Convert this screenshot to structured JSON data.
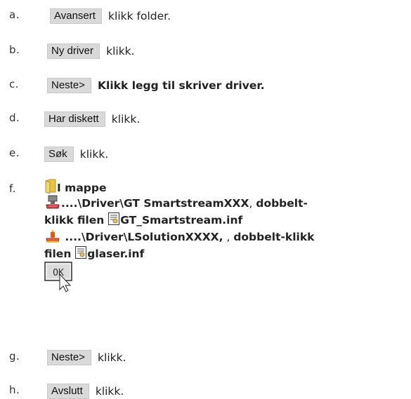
{
  "steps": [
    {
      "marker": "a.",
      "button": "Avansert",
      "text": "klikk folder."
    },
    {
      "marker": "b.",
      "button": "Ny driver",
      "text": "klikk."
    },
    {
      "marker": "c.",
      "button": "Neste>",
      "text": "Klikk legg til skriver driver."
    },
    {
      "marker": "d.",
      "button": "Har diskett",
      "text": "klikk."
    },
    {
      "marker": "e.",
      "button": "Søk",
      "text": "klikk."
    },
    {
      "marker": "f.",
      "folder_label": "I mappe",
      "path1": "....\\Driver\\GT SmartstreamXXX",
      "path1_sep": ",",
      "path1_action": "dobbelt-",
      "path1_action2": "klikk filen",
      "file1": "GT_Smartstream.inf",
      "path2": " ....\\Driver\\LSolutionXXXX,",
      "path2_sep": ",",
      "path2_action": "dobbelt-klikk",
      "path2_action2": "filen",
      "file2": "glaser.inf",
      "ok_label": "OK",
      "icons": [
        "folder-icon",
        "printer-driver-icon",
        "inf-file-icon",
        "printer-driver-alt-icon",
        "ok-button-cursor-icon"
      ]
    },
    {
      "marker": "g.",
      "button": "Neste>",
      "text": "klikk."
    },
    {
      "marker": "h.",
      "button": "Avslutt",
      "text": "klikk."
    }
  ],
  "colors": {
    "button_bg": "#d9d9d9",
    "text": "#222222",
    "folder": "#e8c14a"
  }
}
